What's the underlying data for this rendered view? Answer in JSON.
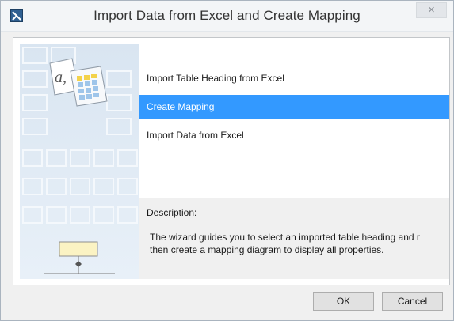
{
  "window": {
    "title": "Import Data from Excel and Create Mapping",
    "close_glyph": "×"
  },
  "illustration": {
    "note_text": "a,"
  },
  "actions": [
    {
      "label": "Import Table Heading from Excel",
      "selected": false
    },
    {
      "label": "Create Mapping",
      "selected": true
    },
    {
      "label": "Import Data from Excel",
      "selected": false
    }
  ],
  "description": {
    "label": "Description:",
    "text": "The wizard guides you to select an imported table heading and r\nthen create a mapping diagram to display all properties."
  },
  "buttons": {
    "ok": "OK",
    "cancel": "Cancel"
  },
  "colors": {
    "selection": "#3399ff",
    "dialog_bg": "#f0f0f0"
  },
  "icons": {
    "app": "magicdraw-app-icon",
    "close": "close-icon"
  }
}
